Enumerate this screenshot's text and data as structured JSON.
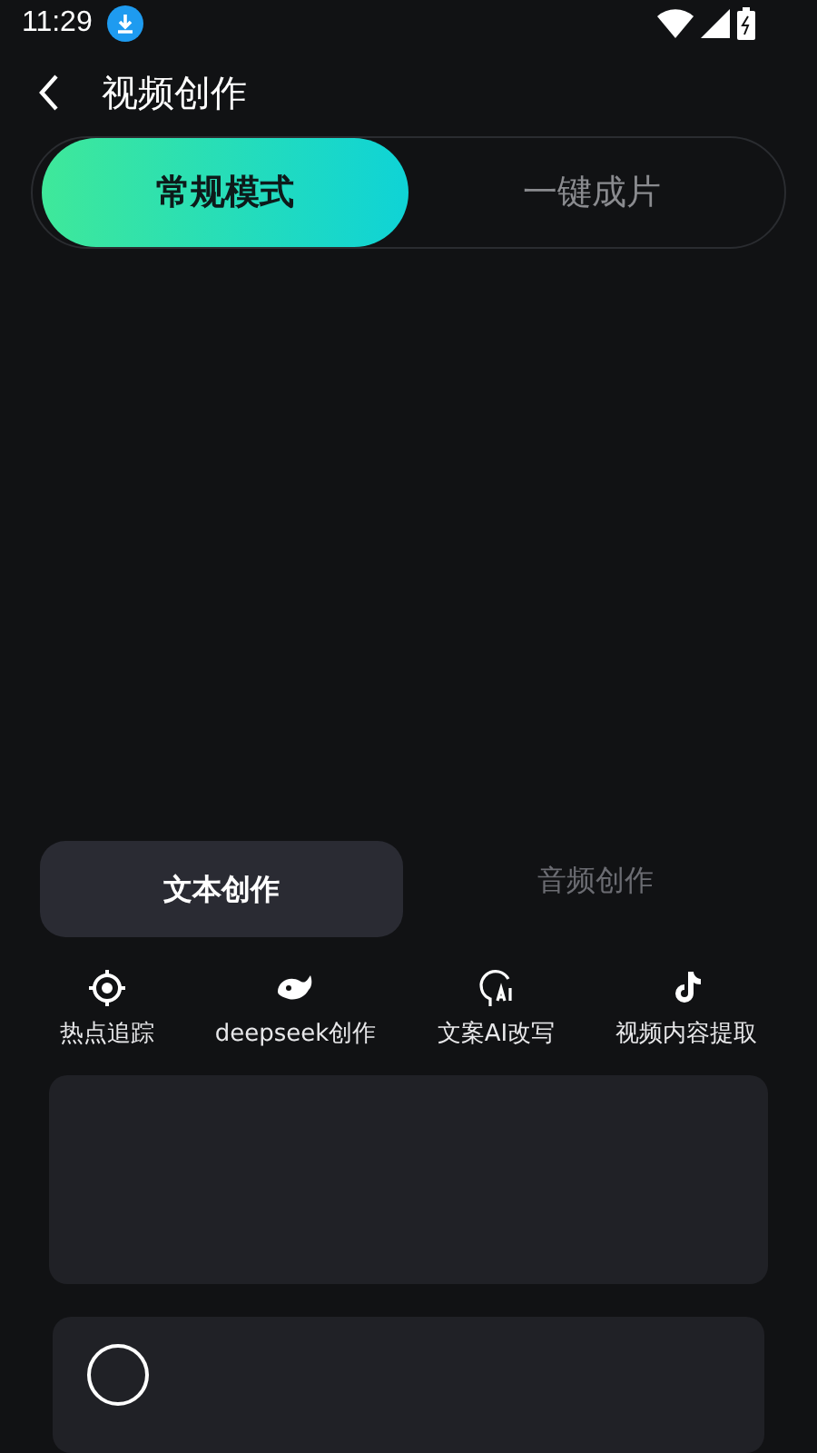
{
  "status_bar": {
    "time": "11:29"
  },
  "header": {
    "title": "视频创作"
  },
  "modes": [
    {
      "label": "常规模式",
      "selected": true
    },
    {
      "label": "一键成片",
      "selected": false
    }
  ],
  "sub_tabs": [
    {
      "label": "文本创作",
      "selected": true
    },
    {
      "label": "音频创作",
      "selected": false
    }
  ],
  "tools": [
    {
      "label": "热点追踪",
      "kind": "target"
    },
    {
      "label": "deepseek创作",
      "kind": "whale"
    },
    {
      "label": "文案AI改写",
      "kind": "ai"
    },
    {
      "label": "视频内容提取",
      "kind": "note"
    }
  ],
  "text_card": {
    "kind": "empty"
  }
}
